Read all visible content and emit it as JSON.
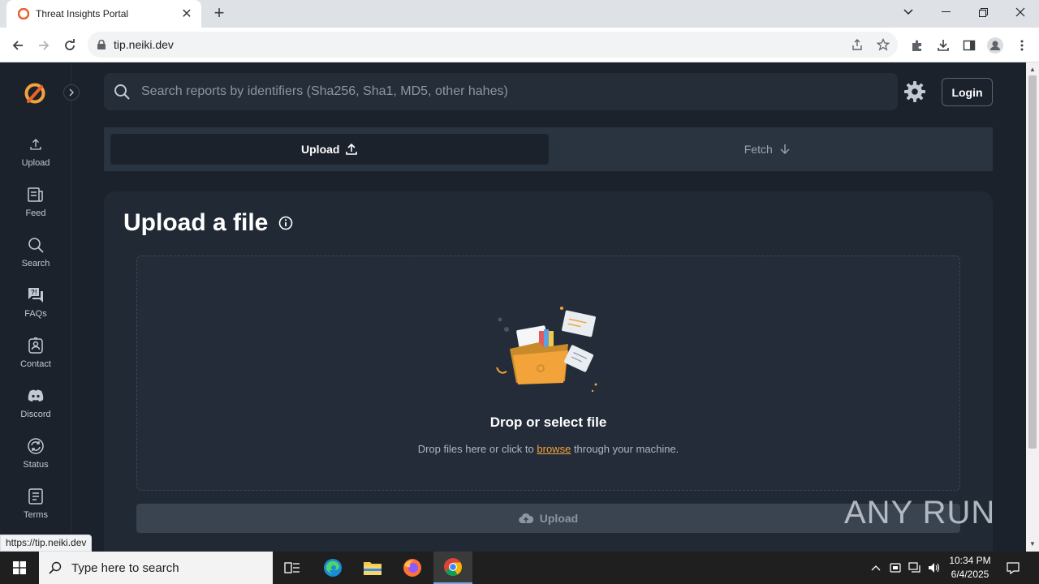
{
  "browser": {
    "tab_title": "Threat Insights Portal",
    "url": "tip.neiki.dev",
    "status_url": "https://tip.neiki.dev"
  },
  "sidebar": {
    "items": [
      {
        "label": "Upload",
        "icon": "upload-icon"
      },
      {
        "label": "Feed",
        "icon": "feed-icon"
      },
      {
        "label": "Search",
        "icon": "search-icon"
      },
      {
        "label": "FAQs",
        "icon": "faq-icon"
      },
      {
        "label": "Contact",
        "icon": "contact-icon"
      },
      {
        "label": "Discord",
        "icon": "discord-icon"
      },
      {
        "label": "Status",
        "icon": "status-icon"
      },
      {
        "label": "Terms",
        "icon": "terms-icon"
      }
    ]
  },
  "header": {
    "search_placeholder": "Search reports by identifiers (Sha256, Sha1, MD5, other hahes)",
    "login_label": "Login"
  },
  "switcher": {
    "upload_label": "Upload",
    "fetch_label": "Fetch"
  },
  "upload_card": {
    "title": "Upload a file",
    "drop_title": "Drop or select file",
    "drop_sub_before": "Drop files here or click to",
    "drop_sub_link": "browse",
    "drop_sub_after": "through your machine.",
    "upload_button": "Upload"
  },
  "watermark": "ANY RUN",
  "taskbar": {
    "search_placeholder": "Type here to search",
    "time": "10:34 PM",
    "date": "6/4/2025"
  },
  "colors": {
    "background": "#1b222c",
    "card": "#212934",
    "accent": "#f2a33a"
  }
}
